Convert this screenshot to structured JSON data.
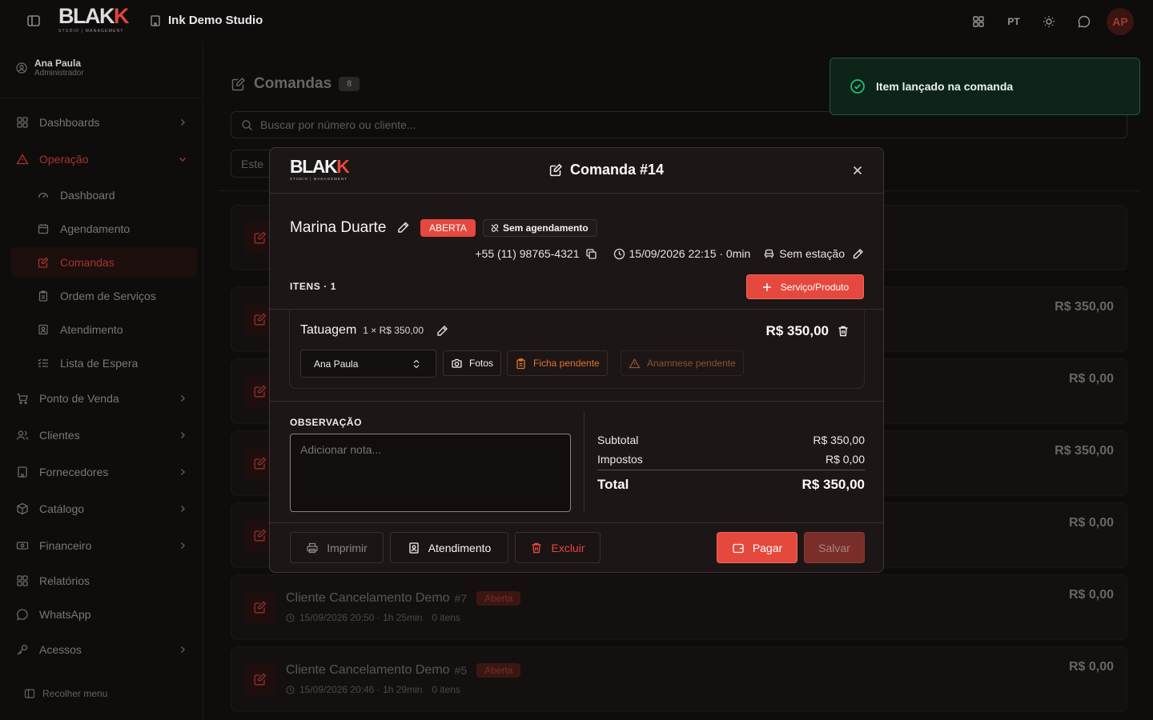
{
  "header": {
    "logo_text": "BLAKK",
    "logo_tagline": "STUDIO | MANAGEMENT",
    "studio_name": "Ink Demo Studio",
    "language": "PT",
    "avatar_initials": "AP"
  },
  "user": {
    "name": "Ana Paula",
    "role": "Administrador"
  },
  "sidebar": {
    "items": [
      {
        "label": "Dashboards",
        "icon": "dashboard-icon"
      },
      {
        "label": "Operação",
        "icon": "warning-triangle-icon"
      },
      {
        "label": "Dashboard",
        "icon": "gauge-icon"
      },
      {
        "label": "Agendamento",
        "icon": "calendar-icon"
      },
      {
        "label": "Comandas",
        "icon": "order-icon"
      },
      {
        "label": "Ordem de Serviços",
        "icon": "clipboard-icon"
      },
      {
        "label": "Atendimento",
        "icon": "service-icon"
      },
      {
        "label": "Lista de Espera",
        "icon": "list-icon"
      },
      {
        "label": "Ponto de Venda",
        "icon": "cart-icon"
      },
      {
        "label": "Clientes",
        "icon": "users-icon"
      },
      {
        "label": "Fornecedores",
        "icon": "building-icon"
      },
      {
        "label": "Catálogo",
        "icon": "package-icon"
      },
      {
        "label": "Financeiro",
        "icon": "money-icon"
      },
      {
        "label": "Relatórios",
        "icon": "reports-icon"
      },
      {
        "label": "WhatsApp",
        "icon": "chat-icon"
      },
      {
        "label": "Acessos",
        "icon": "key-icon"
      }
    ],
    "collapse_label": "Recolher menu"
  },
  "main": {
    "title": "Comandas",
    "count": "8",
    "search_placeholder": "Buscar por número ou cliente...",
    "filter_value": "Este",
    "rows": [
      {
        "name": "",
        "number": "",
        "status": "",
        "meta": "",
        "value": ""
      },
      {
        "name": "",
        "number": "",
        "status": "",
        "meta": "",
        "value": "R$ 350,00"
      },
      {
        "name": "",
        "number": "",
        "status": "",
        "meta": "",
        "value": "R$ 0,00"
      },
      {
        "name": "",
        "number": "",
        "status": "",
        "meta": "",
        "value": "R$ 350,00"
      },
      {
        "name": "",
        "number": "",
        "status": "",
        "meta": "",
        "value": "R$ 0,00"
      },
      {
        "name": "Cliente Cancelamento Demo",
        "number": "#7",
        "status": "Aberta",
        "meta": "15/09/2026 20:50 · 1h 25min",
        "items": "0 itens",
        "value": "R$ 0,00"
      },
      {
        "name": "Cliente Cancelamento Demo",
        "number": "#5",
        "status": "Aberta",
        "meta": "15/09/2026 20:46 · 1h 29min",
        "items": "0 itens",
        "value": "R$ 0,00"
      }
    ]
  },
  "toast": {
    "message": "Item lançado na comanda",
    "color": "#22c37a"
  },
  "modal": {
    "logo_text": "BLAKK",
    "logo_tagline": "STUDIO | MANAGEMENT",
    "title": "Comanda #14",
    "client_name": "Marina Duarte",
    "status_badge": "ABERTA",
    "appointment_badge": "Sem agendamento",
    "phone": "+55 (11) 98765-4321",
    "datetime": "15/09/2026 22:15 · 0min",
    "station": "Sem estação",
    "items_label": "ITENS · 1",
    "add_button": "Serviço/Produto",
    "item": {
      "name": "Tatuagem",
      "qty_price": "1 × R$ 350,00",
      "total": "R$ 350,00",
      "professional": "Ana Paula",
      "photos_label": "Fotos",
      "ficha_label": "Ficha pendente",
      "anamnese_label": "Anamnese pendente"
    },
    "observation_label": "OBSERVAÇÃO",
    "observation_placeholder": "Adicionar nota...",
    "summary": {
      "subtotal_label": "Subtotal",
      "subtotal_value": "R$ 350,00",
      "taxes_label": "Impostos",
      "taxes_value": "R$ 0,00",
      "total_label": "Total",
      "total_value": "R$ 350,00"
    },
    "buttons": {
      "print": "Imprimir",
      "service": "Atendimento",
      "delete": "Excluir",
      "pay": "Pagar",
      "save": "Salvar"
    },
    "accent_color": "#e5483d"
  }
}
